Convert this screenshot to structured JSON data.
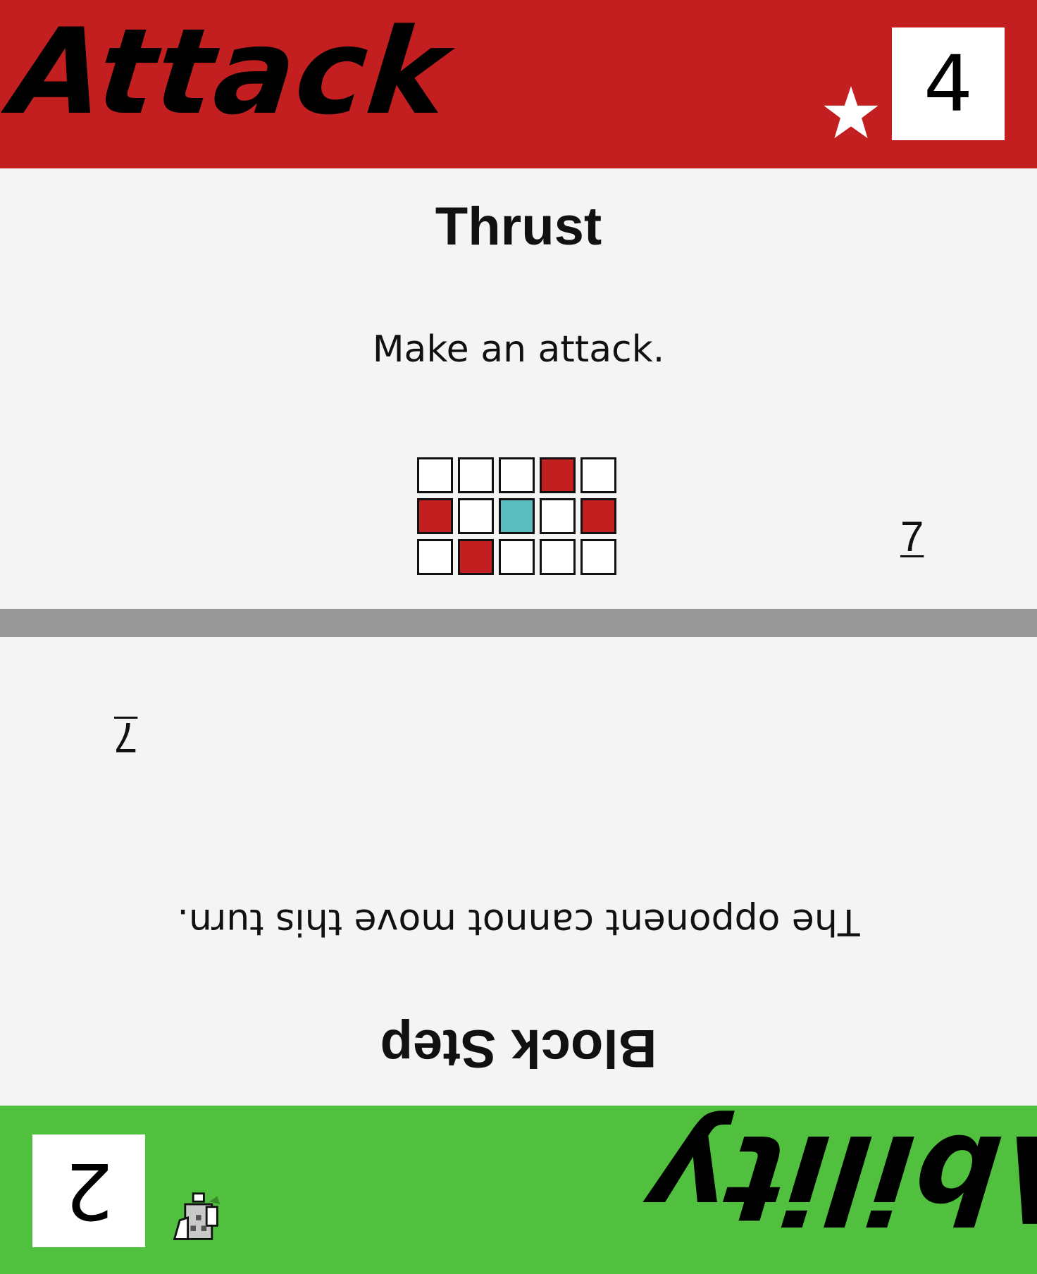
{
  "top_card": {
    "type_label": "Attack",
    "cost": "4",
    "title": "Thrust",
    "description": "Make an attack.",
    "speed": "7",
    "band_color": "#c31f20",
    "icon": "star-icon",
    "pattern": [
      [
        "empty",
        "empty",
        "empty",
        "hit",
        "empty"
      ],
      [
        "hit",
        "empty",
        "self",
        "empty",
        "hit"
      ],
      [
        "empty",
        "hit",
        "empty",
        "empty",
        "empty"
      ]
    ]
  },
  "bottom_card": {
    "type_label": "Ability",
    "cost": "2",
    "title": "Block Step",
    "description": "The opponent cannot move this turn.",
    "speed": "7",
    "band_color": "#52c03f",
    "icon": "character-icon",
    "orientation": "upside-down"
  },
  "colors": {
    "divider": "#999999",
    "self_cell": "#5bbcbf",
    "background": "#f4f4f4"
  }
}
